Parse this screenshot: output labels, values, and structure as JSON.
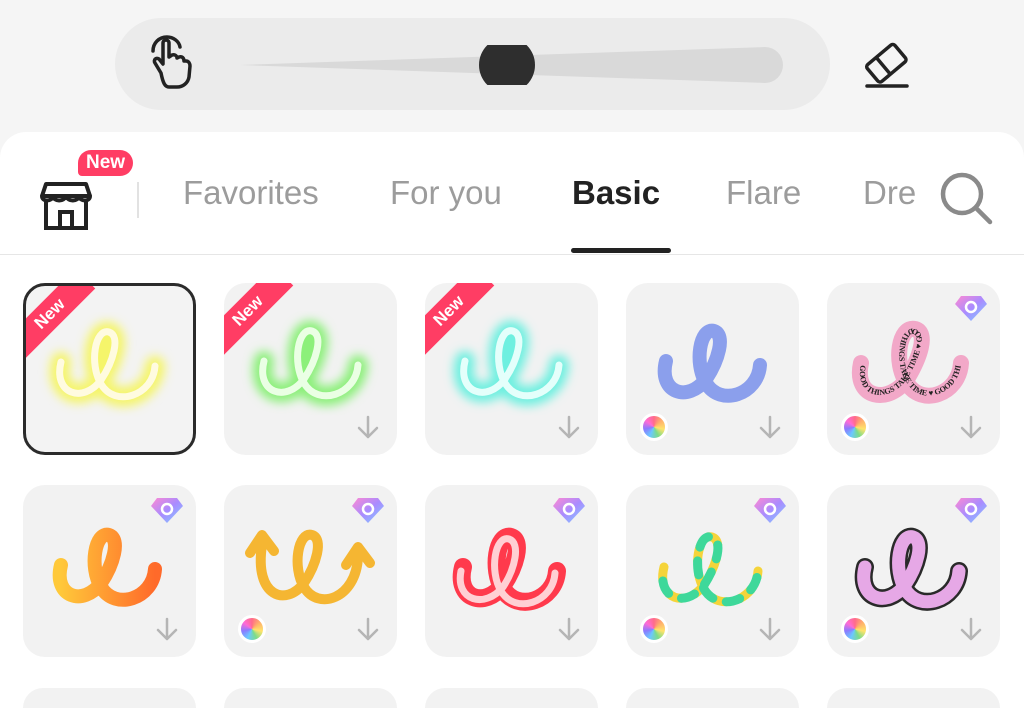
{
  "colors": {
    "accent_new": "#ff3d64",
    "tab_active": "#222222",
    "tab_inactive": "#9c9c9c",
    "panel_bg": "#ffffff",
    "tile_bg": "#f2f2f2"
  },
  "toolbar": {
    "hand_icon": "hand-pointer-icon",
    "eraser_icon": "eraser-icon",
    "brush_size_level": 0.49
  },
  "tabs": {
    "store_badge": "New",
    "items": [
      {
        "label": "Favorites"
      },
      {
        "label": "For you"
      },
      {
        "label": "Basic"
      },
      {
        "label": "Flare"
      },
      {
        "label": "Dre"
      }
    ],
    "active_index": 2
  },
  "brushes": {
    "new_label": "New",
    "ring_text": "GOOD THINGS TAKE TIME",
    "items": [
      {
        "name": "neon-yellow",
        "new": true,
        "selected": true
      },
      {
        "name": "neon-green",
        "new": true
      },
      {
        "name": "neon-cyan",
        "new": true
      },
      {
        "name": "blue-marker"
      },
      {
        "name": "pink-text-brush",
        "premium": true
      },
      {
        "name": "orange-gradient",
        "premium": true
      },
      {
        "name": "yellow-arrow",
        "premium": true
      },
      {
        "name": "red-3d",
        "premium": true
      },
      {
        "name": "dashed-colorful",
        "premium": true
      },
      {
        "name": "purple-outline",
        "premium": true
      }
    ]
  }
}
